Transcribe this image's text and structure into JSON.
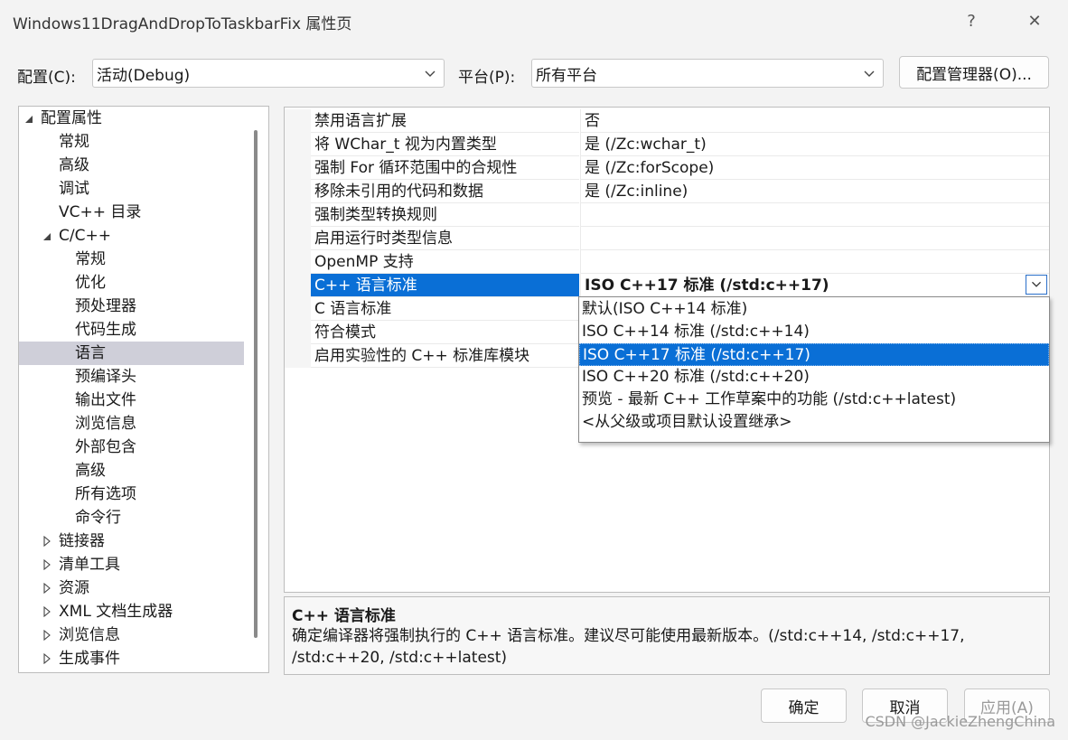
{
  "window": {
    "title": "Windows11DragAndDropToTaskbarFix 属性页",
    "help_glyph": "?",
    "close_glyph": "✕"
  },
  "config": {
    "config_label": "配置(C):",
    "config_value": "活动(Debug)",
    "platform_label": "平台(P):",
    "platform_value": "所有平台",
    "manager_button": "配置管理器(O)..."
  },
  "tree": {
    "items": [
      {
        "label": "配置属性",
        "level": 0,
        "expanded": true
      },
      {
        "label": "常规",
        "level": 1
      },
      {
        "label": "高级",
        "level": 1
      },
      {
        "label": "调试",
        "level": 1
      },
      {
        "label": "VC++ 目录",
        "level": 1
      },
      {
        "label": "C/C++",
        "level": 1,
        "expanded": true
      },
      {
        "label": "常规",
        "level": 2
      },
      {
        "label": "优化",
        "level": 2
      },
      {
        "label": "预处理器",
        "level": 2
      },
      {
        "label": "代码生成",
        "level": 2
      },
      {
        "label": "语言",
        "level": 2,
        "selected": true
      },
      {
        "label": "预编译头",
        "level": 2
      },
      {
        "label": "输出文件",
        "level": 2
      },
      {
        "label": "浏览信息",
        "level": 2
      },
      {
        "label": "外部包含",
        "level": 2
      },
      {
        "label": "高级",
        "level": 2
      },
      {
        "label": "所有选项",
        "level": 2
      },
      {
        "label": "命令行",
        "level": 2
      },
      {
        "label": "链接器",
        "level": 1,
        "collapsed": true
      },
      {
        "label": "清单工具",
        "level": 1,
        "collapsed": true
      },
      {
        "label": "资源",
        "level": 1,
        "collapsed": true
      },
      {
        "label": "XML 文档生成器",
        "level": 1,
        "collapsed": true
      },
      {
        "label": "浏览信息",
        "level": 1,
        "collapsed": true
      },
      {
        "label": "生成事件",
        "level": 1,
        "collapsed": true
      }
    ]
  },
  "grid": {
    "rows": [
      {
        "name": "禁用语言扩展",
        "value": "否"
      },
      {
        "name": "将 WChar_t 视为内置类型",
        "value": "是 (/Zc:wchar_t)"
      },
      {
        "name": "强制 For 循环范围中的合规性",
        "value": "是 (/Zc:forScope)"
      },
      {
        "name": "移除未引用的代码和数据",
        "value": "是 (/Zc:inline)"
      },
      {
        "name": "强制类型转换规则",
        "value": ""
      },
      {
        "name": "启用运行时类型信息",
        "value": ""
      },
      {
        "name": "OpenMP 支持",
        "value": ""
      },
      {
        "name": "C++ 语言标准",
        "value": "ISO C++17 标准 (/std:c++17)",
        "selected": true
      },
      {
        "name": "C 语言标准",
        "value": ""
      },
      {
        "name": "符合模式",
        "value": ""
      },
      {
        "name": "启用实验性的 C++ 标准库模块",
        "value": ""
      }
    ]
  },
  "dropdown": {
    "options": [
      {
        "label": "默认(ISO C++14 标准)"
      },
      {
        "label": "ISO C++14 标准 (/std:c++14)"
      },
      {
        "label": "ISO C++17 标准 (/std:c++17)",
        "selected": true
      },
      {
        "label": "ISO C++20 标准 (/std:c++20)"
      },
      {
        "label": "预览 - 最新 C++ 工作草案中的功能 (/std:c++latest)"
      },
      {
        "label": "<从父级或项目默认设置继承>"
      }
    ]
  },
  "description": {
    "title": "C++ 语言标准",
    "text": "确定编译器将强制执行的 C++ 语言标准。建议尽可能使用最新版本。(/std:c++14, /std:c++17, /std:c++20, /std:c++latest)"
  },
  "buttons": {
    "ok": "确定",
    "cancel": "取消",
    "apply": "应用(A)"
  },
  "watermark": "CSDN @JackieZhengChina",
  "colors": {
    "accent": "#0a6fd6",
    "tree_selected": "#cfcfd9",
    "window_bg": "#f3f3f3"
  }
}
